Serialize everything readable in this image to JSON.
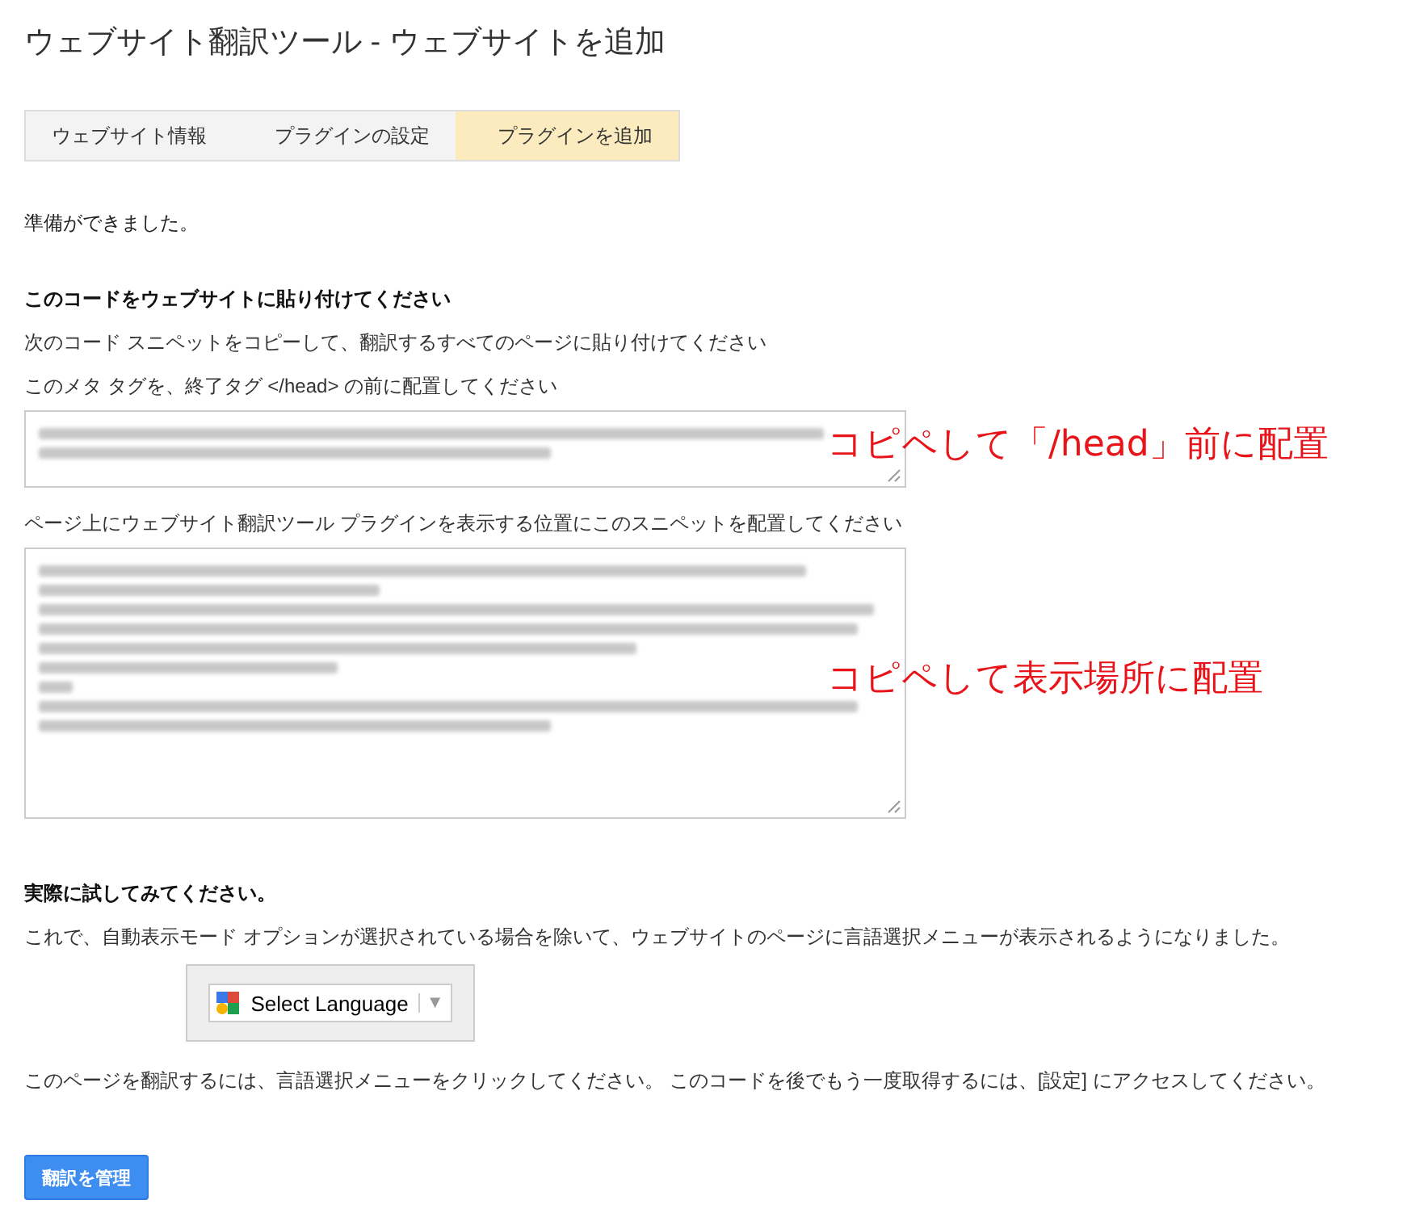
{
  "title": "ウェブサイト翻訳ツール - ウェブサイトを追加",
  "steps": [
    {
      "label": "ウェブサイト情報",
      "selected": false
    },
    {
      "label": "プラグインの設定",
      "selected": false
    },
    {
      "label": "プラグインを追加",
      "selected": true
    }
  ],
  "ready_text": "準備ができました。",
  "paste_heading": "このコードをウェブサイトに貼り付けてください",
  "paste_lines": [
    "次のコード スニペットをコピーして、翻訳するすべてのページに貼り付けてください",
    "このメタ タグを、終了タグ </head> の前に配置してください"
  ],
  "snippets": [
    {
      "annotation": "コピペして「/head」前に配置"
    },
    {
      "annotation": "コピペして表示場所に配置",
      "before": "ページ上にウェブサイト翻訳ツール プラグインを表示する位置にこのスニペットを配置してください"
    }
  ],
  "try_heading": "実際に試してみてください。",
  "try_text": "これで、自動表示モード オプションが選択されている場合を除いて、ウェブサイトのページに言語選択メニューが表示されるようになりました。",
  "language_select": {
    "value": "Select Language",
    "caret": "▼"
  },
  "info_text": "このページを翻訳するには、言語選択メニューをクリックしてください。 このコードを後でもう一度取得するには、[設定] にアクセスしてください。",
  "manage_button": "翻訳を管理"
}
